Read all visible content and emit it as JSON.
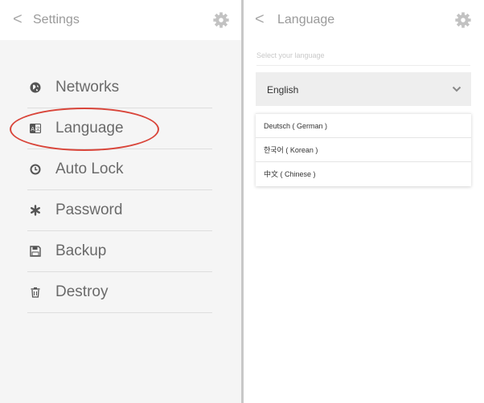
{
  "left_panel": {
    "header": {
      "back_label": "<",
      "title": "Settings",
      "gear_icon": "gear-icon"
    },
    "menu": [
      {
        "label": "Networks",
        "icon": "globe-icon"
      },
      {
        "label": "Language",
        "icon": "language-icon"
      },
      {
        "label": "Auto Lock",
        "icon": "clock-icon"
      },
      {
        "label": "Password",
        "icon": "asterisk-icon"
      },
      {
        "label": "Backup",
        "icon": "floppy-disk-icon"
      },
      {
        "label": "Destroy",
        "icon": "trash-icon"
      }
    ],
    "highlighted_item": "Language"
  },
  "right_panel": {
    "header": {
      "back_label": "<",
      "title": "Language",
      "gear_icon": "gear-icon"
    },
    "select_hint": "Select your language",
    "selected_value": "English",
    "options": [
      "Deutsch ( German )",
      "한국어 ( Korean )",
      "中文 ( Chinese )"
    ]
  },
  "colors": {
    "highlight": "#d9453a",
    "panel_bg": "#f5f5f5",
    "divider": "#c8c8c8"
  }
}
